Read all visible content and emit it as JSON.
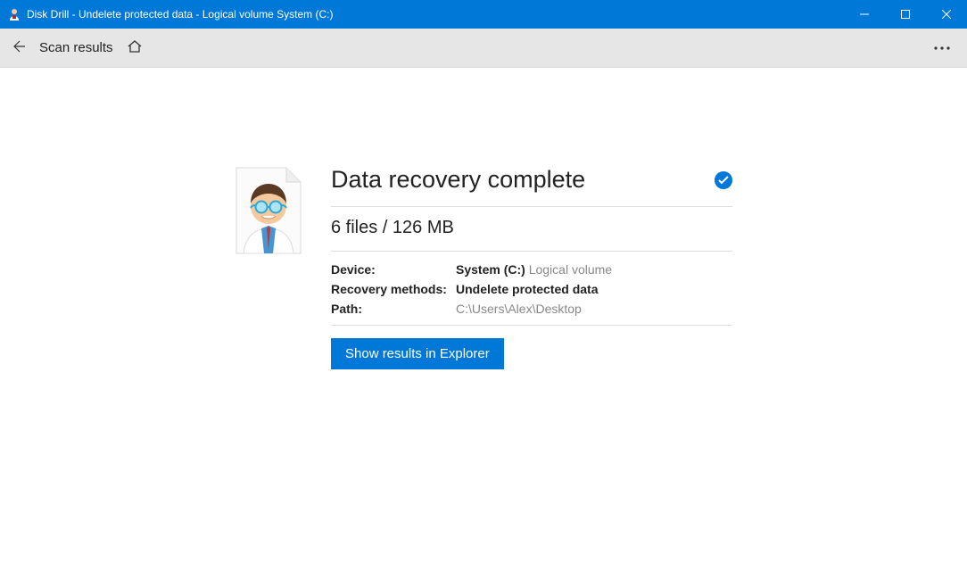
{
  "window": {
    "title": "Disk Drill - Undelete protected data - Logical volume System (C:)"
  },
  "toolbar": {
    "breadcrumb": "Scan results"
  },
  "result": {
    "heading": "Data recovery complete",
    "summary": "6 files / 126 MB",
    "device_label": "Device:",
    "device_value": "System (C:)",
    "device_type": "Logical volume",
    "methods_label": "Recovery methods:",
    "methods_value": "Undelete protected data",
    "path_label": "Path:",
    "path_value": "C:\\Users\\Alex\\Desktop",
    "button_label": "Show results in Explorer"
  }
}
